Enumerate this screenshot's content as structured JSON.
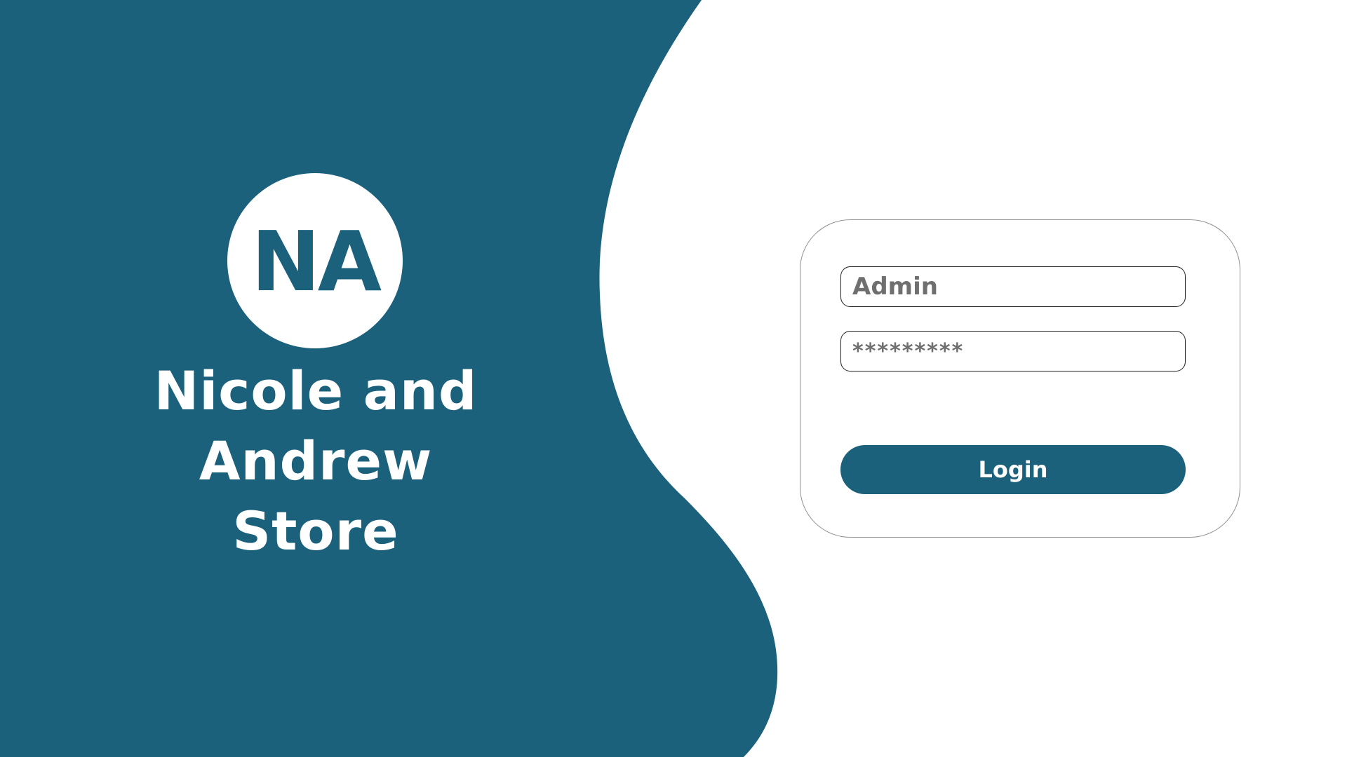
{
  "brand": {
    "logo_text": "NA",
    "title_line1": "Nicole and Andrew",
    "title_line2": "Store"
  },
  "login": {
    "username_value": "Admin",
    "password_value": "*********",
    "button_label": "Login"
  },
  "colors": {
    "brand_teal": "#1b617c",
    "background": "#ffffff",
    "field_text": "#6f6f6f",
    "card_border": "#8f8f8f"
  }
}
